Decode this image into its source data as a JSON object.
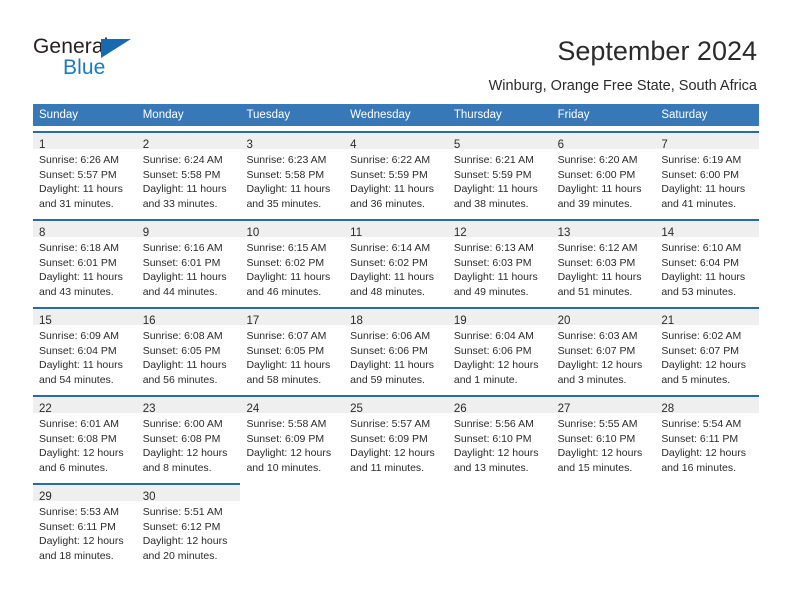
{
  "brand": {
    "name_part1": "General",
    "name_part2": "Blue",
    "triangle_icon": "triangle-icon",
    "accent_dark": "#1769b0",
    "accent_light": "#1b7ac4"
  },
  "header": {
    "title": "September 2024",
    "subtitle": "Winburg, Orange Free State, South Africa"
  },
  "calendar": {
    "header_color": "#3778b9",
    "cell_top_border_color": "#2a6aa8",
    "day_number_band_color": "#efefef",
    "weekdays": [
      "Sunday",
      "Monday",
      "Tuesday",
      "Wednesday",
      "Thursday",
      "Friday",
      "Saturday"
    ],
    "weeks": [
      [
        {
          "day": "1",
          "sunrise": "Sunrise: 6:26 AM",
          "sunset": "Sunset: 5:57 PM",
          "daylight_line1": "Daylight: 11 hours",
          "daylight_line2": "and 31 minutes."
        },
        {
          "day": "2",
          "sunrise": "Sunrise: 6:24 AM",
          "sunset": "Sunset: 5:58 PM",
          "daylight_line1": "Daylight: 11 hours",
          "daylight_line2": "and 33 minutes."
        },
        {
          "day": "3",
          "sunrise": "Sunrise: 6:23 AM",
          "sunset": "Sunset: 5:58 PM",
          "daylight_line1": "Daylight: 11 hours",
          "daylight_line2": "and 35 minutes."
        },
        {
          "day": "4",
          "sunrise": "Sunrise: 6:22 AM",
          "sunset": "Sunset: 5:59 PM",
          "daylight_line1": "Daylight: 11 hours",
          "daylight_line2": "and 36 minutes."
        },
        {
          "day": "5",
          "sunrise": "Sunrise: 6:21 AM",
          "sunset": "Sunset: 5:59 PM",
          "daylight_line1": "Daylight: 11 hours",
          "daylight_line2": "and 38 minutes."
        },
        {
          "day": "6",
          "sunrise": "Sunrise: 6:20 AM",
          "sunset": "Sunset: 6:00 PM",
          "daylight_line1": "Daylight: 11 hours",
          "daylight_line2": "and 39 minutes."
        },
        {
          "day": "7",
          "sunrise": "Sunrise: 6:19 AM",
          "sunset": "Sunset: 6:00 PM",
          "daylight_line1": "Daylight: 11 hours",
          "daylight_line2": "and 41 minutes."
        }
      ],
      [
        {
          "day": "8",
          "sunrise": "Sunrise: 6:18 AM",
          "sunset": "Sunset: 6:01 PM",
          "daylight_line1": "Daylight: 11 hours",
          "daylight_line2": "and 43 minutes."
        },
        {
          "day": "9",
          "sunrise": "Sunrise: 6:16 AM",
          "sunset": "Sunset: 6:01 PM",
          "daylight_line1": "Daylight: 11 hours",
          "daylight_line2": "and 44 minutes."
        },
        {
          "day": "10",
          "sunrise": "Sunrise: 6:15 AM",
          "sunset": "Sunset: 6:02 PM",
          "daylight_line1": "Daylight: 11 hours",
          "daylight_line2": "and 46 minutes."
        },
        {
          "day": "11",
          "sunrise": "Sunrise: 6:14 AM",
          "sunset": "Sunset: 6:02 PM",
          "daylight_line1": "Daylight: 11 hours",
          "daylight_line2": "and 48 minutes."
        },
        {
          "day": "12",
          "sunrise": "Sunrise: 6:13 AM",
          "sunset": "Sunset: 6:03 PM",
          "daylight_line1": "Daylight: 11 hours",
          "daylight_line2": "and 49 minutes."
        },
        {
          "day": "13",
          "sunrise": "Sunrise: 6:12 AM",
          "sunset": "Sunset: 6:03 PM",
          "daylight_line1": "Daylight: 11 hours",
          "daylight_line2": "and 51 minutes."
        },
        {
          "day": "14",
          "sunrise": "Sunrise: 6:10 AM",
          "sunset": "Sunset: 6:04 PM",
          "daylight_line1": "Daylight: 11 hours",
          "daylight_line2": "and 53 minutes."
        }
      ],
      [
        {
          "day": "15",
          "sunrise": "Sunrise: 6:09 AM",
          "sunset": "Sunset: 6:04 PM",
          "daylight_line1": "Daylight: 11 hours",
          "daylight_line2": "and 54 minutes."
        },
        {
          "day": "16",
          "sunrise": "Sunrise: 6:08 AM",
          "sunset": "Sunset: 6:05 PM",
          "daylight_line1": "Daylight: 11 hours",
          "daylight_line2": "and 56 minutes."
        },
        {
          "day": "17",
          "sunrise": "Sunrise: 6:07 AM",
          "sunset": "Sunset: 6:05 PM",
          "daylight_line1": "Daylight: 11 hours",
          "daylight_line2": "and 58 minutes."
        },
        {
          "day": "18",
          "sunrise": "Sunrise: 6:06 AM",
          "sunset": "Sunset: 6:06 PM",
          "daylight_line1": "Daylight: 11 hours",
          "daylight_line2": "and 59 minutes."
        },
        {
          "day": "19",
          "sunrise": "Sunrise: 6:04 AM",
          "sunset": "Sunset: 6:06 PM",
          "daylight_line1": "Daylight: 12 hours",
          "daylight_line2": "and 1 minute."
        },
        {
          "day": "20",
          "sunrise": "Sunrise: 6:03 AM",
          "sunset": "Sunset: 6:07 PM",
          "daylight_line1": "Daylight: 12 hours",
          "daylight_line2": "and 3 minutes."
        },
        {
          "day": "21",
          "sunrise": "Sunrise: 6:02 AM",
          "sunset": "Sunset: 6:07 PM",
          "daylight_line1": "Daylight: 12 hours",
          "daylight_line2": "and 5 minutes."
        }
      ],
      [
        {
          "day": "22",
          "sunrise": "Sunrise: 6:01 AM",
          "sunset": "Sunset: 6:08 PM",
          "daylight_line1": "Daylight: 12 hours",
          "daylight_line2": "and 6 minutes."
        },
        {
          "day": "23",
          "sunrise": "Sunrise: 6:00 AM",
          "sunset": "Sunset: 6:08 PM",
          "daylight_line1": "Daylight: 12 hours",
          "daylight_line2": "and 8 minutes."
        },
        {
          "day": "24",
          "sunrise": "Sunrise: 5:58 AM",
          "sunset": "Sunset: 6:09 PM",
          "daylight_line1": "Daylight: 12 hours",
          "daylight_line2": "and 10 minutes."
        },
        {
          "day": "25",
          "sunrise": "Sunrise: 5:57 AM",
          "sunset": "Sunset: 6:09 PM",
          "daylight_line1": "Daylight: 12 hours",
          "daylight_line2": "and 11 minutes."
        },
        {
          "day": "26",
          "sunrise": "Sunrise: 5:56 AM",
          "sunset": "Sunset: 6:10 PM",
          "daylight_line1": "Daylight: 12 hours",
          "daylight_line2": "and 13 minutes."
        },
        {
          "day": "27",
          "sunrise": "Sunrise: 5:55 AM",
          "sunset": "Sunset: 6:10 PM",
          "daylight_line1": "Daylight: 12 hours",
          "daylight_line2": "and 15 minutes."
        },
        {
          "day": "28",
          "sunrise": "Sunrise: 5:54 AM",
          "sunset": "Sunset: 6:11 PM",
          "daylight_line1": "Daylight: 12 hours",
          "daylight_line2": "and 16 minutes."
        }
      ],
      [
        {
          "day": "29",
          "sunrise": "Sunrise: 5:53 AM",
          "sunset": "Sunset: 6:11 PM",
          "daylight_line1": "Daylight: 12 hours",
          "daylight_line2": "and 18 minutes."
        },
        {
          "day": "30",
          "sunrise": "Sunrise: 5:51 AM",
          "sunset": "Sunset: 6:12 PM",
          "daylight_line1": "Daylight: 12 hours",
          "daylight_line2": "and 20 minutes."
        },
        {
          "day": "",
          "sunrise": "",
          "sunset": "",
          "daylight_line1": "",
          "daylight_line2": ""
        },
        {
          "day": "",
          "sunrise": "",
          "sunset": "",
          "daylight_line1": "",
          "daylight_line2": ""
        },
        {
          "day": "",
          "sunrise": "",
          "sunset": "",
          "daylight_line1": "",
          "daylight_line2": ""
        },
        {
          "day": "",
          "sunrise": "",
          "sunset": "",
          "daylight_line1": "",
          "daylight_line2": ""
        },
        {
          "day": "",
          "sunrise": "",
          "sunset": "",
          "daylight_line1": "",
          "daylight_line2": ""
        }
      ]
    ]
  }
}
